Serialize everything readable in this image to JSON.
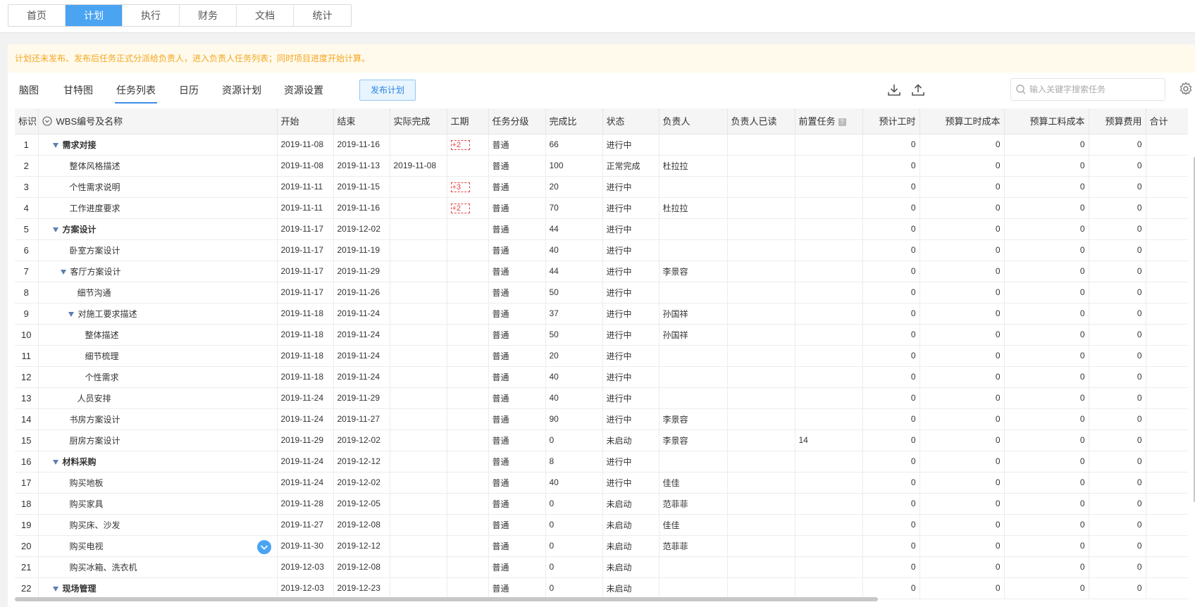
{
  "top_tabs": [
    {
      "label": "首页",
      "active": false
    },
    {
      "label": "计划",
      "active": true
    },
    {
      "label": "执行",
      "active": false
    },
    {
      "label": "财务",
      "active": false
    },
    {
      "label": "文档",
      "active": false
    },
    {
      "label": "统计",
      "active": false
    }
  ],
  "notice": "计划还未发布、发布后任务正式分派给负责人，进入负责人任务列表；同时项目进度开始计算。",
  "sub_tabs": [
    {
      "label": "脑图",
      "active": false
    },
    {
      "label": "甘特图",
      "active": false
    },
    {
      "label": "任务列表",
      "active": true
    },
    {
      "label": "日历",
      "active": false
    },
    {
      "label": "资源计划",
      "active": false
    },
    {
      "label": "资源设置",
      "active": false
    }
  ],
  "publish_label": "发布计划",
  "search": {
    "placeholder": "输入关键字搜索任务",
    "value": ""
  },
  "columns": [
    "标识",
    "WBS编号及名称",
    "开始",
    "结束",
    "实际完成",
    "工期",
    "任务分级",
    "完成比",
    "状态",
    "负责人",
    "负责人已读",
    "前置任务",
    "预计工时",
    "预算工时成本",
    "预算工料成本",
    "预算费用",
    "合计"
  ],
  "rows": [
    {
      "id": "1",
      "name": "需求对接",
      "level": 0,
      "group": true,
      "start": "2019-11-08",
      "end": "2019-11-16",
      "actual": "",
      "dur": "+2",
      "grade": "普通",
      "pct": "66",
      "status": "进行中",
      "owner": "",
      "read": "",
      "pre": "",
      "h": "0",
      "c1": "0",
      "c2": "0",
      "c3": "0"
    },
    {
      "id": "2",
      "name": "整体风格描述",
      "level": 1,
      "group": false,
      "start": "2019-11-08",
      "end": "2019-11-13",
      "actual": "2019-11-08",
      "dur": "",
      "grade": "普通",
      "pct": "100",
      "status": "正常完成",
      "owner": "杜拉拉",
      "read": "",
      "pre": "",
      "h": "0",
      "c1": "0",
      "c2": "0",
      "c3": "0"
    },
    {
      "id": "3",
      "name": "个性需求说明",
      "level": 1,
      "group": false,
      "start": "2019-11-11",
      "end": "2019-11-15",
      "actual": "",
      "dur": "+3",
      "grade": "普通",
      "pct": "20",
      "status": "进行中",
      "owner": "",
      "read": "",
      "pre": "",
      "h": "0",
      "c1": "0",
      "c2": "0",
      "c3": "0"
    },
    {
      "id": "4",
      "name": "工作进度要求",
      "level": 1,
      "group": false,
      "start": "2019-11-11",
      "end": "2019-11-16",
      "actual": "",
      "dur": "+2",
      "grade": "普通",
      "pct": "70",
      "status": "进行中",
      "owner": "杜拉拉",
      "read": "",
      "pre": "",
      "h": "0",
      "c1": "0",
      "c2": "0",
      "c3": "0"
    },
    {
      "id": "5",
      "name": "方案设计",
      "level": 0,
      "group": true,
      "start": "2019-11-17",
      "end": "2019-12-02",
      "actual": "",
      "dur": "",
      "grade": "普通",
      "pct": "44",
      "status": "进行中",
      "owner": "",
      "read": "",
      "pre": "",
      "h": "0",
      "c1": "0",
      "c2": "0",
      "c3": "0"
    },
    {
      "id": "6",
      "name": "卧室方案设计",
      "level": 1,
      "group": false,
      "start": "2019-11-17",
      "end": "2019-11-19",
      "actual": "",
      "dur": "",
      "grade": "普通",
      "pct": "40",
      "status": "进行中",
      "owner": "",
      "read": "",
      "pre": "",
      "h": "0",
      "c1": "0",
      "c2": "0",
      "c3": "0"
    },
    {
      "id": "7",
      "name": "客厅方案设计",
      "level": 1,
      "group": true,
      "start": "2019-11-17",
      "end": "2019-11-29",
      "actual": "",
      "dur": "",
      "grade": "普通",
      "pct": "44",
      "status": "进行中",
      "owner": "李景容",
      "read": "",
      "pre": "",
      "h": "0",
      "c1": "0",
      "c2": "0",
      "c3": "0"
    },
    {
      "id": "8",
      "name": "细节沟通",
      "level": 2,
      "group": false,
      "start": "2019-11-17",
      "end": "2019-11-26",
      "actual": "",
      "dur": "",
      "grade": "普通",
      "pct": "50",
      "status": "进行中",
      "owner": "",
      "read": "",
      "pre": "",
      "h": "0",
      "c1": "0",
      "c2": "0",
      "c3": "0"
    },
    {
      "id": "9",
      "name": "对施工要求描述",
      "level": 2,
      "group": true,
      "start": "2019-11-18",
      "end": "2019-11-24",
      "actual": "",
      "dur": "",
      "grade": "普通",
      "pct": "37",
      "status": "进行中",
      "owner": "孙国祥",
      "read": "",
      "pre": "",
      "h": "0",
      "c1": "0",
      "c2": "0",
      "c3": "0"
    },
    {
      "id": "10",
      "name": "整体描述",
      "level": 3,
      "group": false,
      "start": "2019-11-18",
      "end": "2019-11-24",
      "actual": "",
      "dur": "",
      "grade": "普通",
      "pct": "50",
      "status": "进行中",
      "owner": "孙国祥",
      "read": "",
      "pre": "",
      "h": "0",
      "c1": "0",
      "c2": "0",
      "c3": "0"
    },
    {
      "id": "11",
      "name": "细节梳理",
      "level": 3,
      "group": false,
      "start": "2019-11-18",
      "end": "2019-11-24",
      "actual": "",
      "dur": "",
      "grade": "普通",
      "pct": "20",
      "status": "进行中",
      "owner": "",
      "read": "",
      "pre": "",
      "h": "0",
      "c1": "0",
      "c2": "0",
      "c3": "0"
    },
    {
      "id": "12",
      "name": "个性需求",
      "level": 3,
      "group": false,
      "start": "2019-11-18",
      "end": "2019-11-24",
      "actual": "",
      "dur": "",
      "grade": "普通",
      "pct": "40",
      "status": "进行中",
      "owner": "",
      "read": "",
      "pre": "",
      "h": "0",
      "c1": "0",
      "c2": "0",
      "c3": "0"
    },
    {
      "id": "13",
      "name": "人员安排",
      "level": 2,
      "group": false,
      "start": "2019-11-24",
      "end": "2019-11-29",
      "actual": "",
      "dur": "",
      "grade": "普通",
      "pct": "40",
      "status": "进行中",
      "owner": "",
      "read": "",
      "pre": "",
      "h": "0",
      "c1": "0",
      "c2": "0",
      "c3": "0"
    },
    {
      "id": "14",
      "name": "书房方案设计",
      "level": 1,
      "group": false,
      "start": "2019-11-24",
      "end": "2019-11-27",
      "actual": "",
      "dur": "",
      "grade": "普通",
      "pct": "90",
      "status": "进行中",
      "owner": "李景容",
      "read": "",
      "pre": "",
      "h": "0",
      "c1": "0",
      "c2": "0",
      "c3": "0"
    },
    {
      "id": "15",
      "name": "厨房方案设计",
      "level": 1,
      "group": false,
      "start": "2019-11-29",
      "end": "2019-12-02",
      "actual": "",
      "dur": "",
      "grade": "普通",
      "pct": "0",
      "status": "未启动",
      "owner": "李景容",
      "read": "",
      "pre": "14",
      "h": "0",
      "c1": "0",
      "c2": "0",
      "c3": "0"
    },
    {
      "id": "16",
      "name": "材料采购",
      "level": 0,
      "group": true,
      "start": "2019-11-24",
      "end": "2019-12-12",
      "actual": "",
      "dur": "",
      "grade": "普通",
      "pct": "8",
      "status": "进行中",
      "owner": "",
      "read": "",
      "pre": "",
      "h": "0",
      "c1": "0",
      "c2": "0",
      "c3": "0"
    },
    {
      "id": "17",
      "name": "购买地板",
      "level": 1,
      "group": false,
      "start": "2019-11-24",
      "end": "2019-12-02",
      "actual": "",
      "dur": "",
      "grade": "普通",
      "pct": "40",
      "status": "进行中",
      "owner": "佳佳",
      "read": "",
      "pre": "",
      "h": "0",
      "c1": "0",
      "c2": "0",
      "c3": "0"
    },
    {
      "id": "18",
      "name": "购买家具",
      "level": 1,
      "group": false,
      "start": "2019-11-28",
      "end": "2019-12-05",
      "actual": "",
      "dur": "",
      "grade": "普通",
      "pct": "0",
      "status": "未启动",
      "owner": "范菲菲",
      "read": "",
      "pre": "",
      "h": "0",
      "c1": "0",
      "c2": "0",
      "c3": "0"
    },
    {
      "id": "19",
      "name": "购买床、沙发",
      "level": 1,
      "group": false,
      "start": "2019-11-27",
      "end": "2019-12-08",
      "actual": "",
      "dur": "",
      "grade": "普通",
      "pct": "0",
      "status": "未启动",
      "owner": "佳佳",
      "read": "",
      "pre": "",
      "h": "0",
      "c1": "0",
      "c2": "0",
      "c3": "0"
    },
    {
      "id": "20",
      "name": "购买电视",
      "level": 1,
      "group": false,
      "action": true,
      "start": "2019-11-30",
      "end": "2019-12-12",
      "actual": "",
      "dur": "",
      "grade": "普通",
      "pct": "0",
      "status": "未启动",
      "owner": "范菲菲",
      "read": "",
      "pre": "",
      "h": "0",
      "c1": "0",
      "c2": "0",
      "c3": "0"
    },
    {
      "id": "21",
      "name": "购买冰箱、洗衣机",
      "level": 1,
      "group": false,
      "start": "2019-12-03",
      "end": "2019-12-08",
      "actual": "",
      "dur": "",
      "grade": "普通",
      "pct": "0",
      "status": "未启动",
      "owner": "",
      "read": "",
      "pre": "",
      "h": "0",
      "c1": "0",
      "c2": "0",
      "c3": "0"
    },
    {
      "id": "22",
      "name": "现场管理",
      "level": 0,
      "group": true,
      "start": "2019-12-03",
      "end": "2019-12-23",
      "actual": "",
      "dur": "",
      "grade": "普通",
      "pct": "0",
      "status": "未启动",
      "owner": "",
      "read": "",
      "pre": "",
      "h": "0",
      "c1": "0",
      "c2": "0",
      "c3": "0"
    }
  ]
}
